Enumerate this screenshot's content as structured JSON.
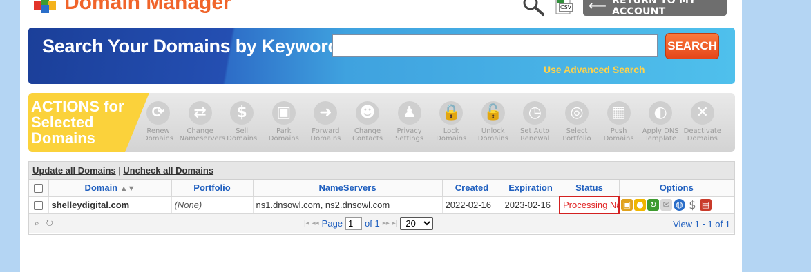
{
  "header": {
    "brand": "Domain Manager",
    "return_label": "RETURN TO MY ACCOUNT",
    "csv_label": "CSV"
  },
  "search": {
    "title": "Search Your Domains by Keyword",
    "input_value": "",
    "button_label": "SEARCH",
    "advanced_link": "Use Advanced Search"
  },
  "actions": {
    "label_lines": [
      "ACTIONS for",
      "Selected",
      "Domains"
    ],
    "items": [
      {
        "line1": "Renew",
        "line2": "Domains",
        "glyph": "⟳"
      },
      {
        "line1": "Change",
        "line2": "Nameservers",
        "glyph": "⇄"
      },
      {
        "line1": "Sell",
        "line2": "Domains",
        "glyph": "$"
      },
      {
        "line1": "Park",
        "line2": "Domains",
        "glyph": "▣"
      },
      {
        "line1": "Forward",
        "line2": "Domains",
        "glyph": "➜"
      },
      {
        "line1": "Change",
        "line2": "Contacts",
        "glyph": "☻"
      },
      {
        "line1": "Privacy",
        "line2": "Settings",
        "glyph": "♟"
      },
      {
        "line1": "Lock",
        "line2": "Domains",
        "glyph": "🔒"
      },
      {
        "line1": "Unlock",
        "line2": "Domains",
        "glyph": "🔓"
      },
      {
        "line1": "Set Auto",
        "line2": "Renewal",
        "glyph": "◷"
      },
      {
        "line1": "Select",
        "line2": "Portfolio",
        "glyph": "◎"
      },
      {
        "line1": "Push",
        "line2": "Domains",
        "glyph": "▦"
      },
      {
        "line1": "Apply DNS",
        "line2": "Template",
        "glyph": "◐"
      },
      {
        "line1": "Deactivate",
        "line2": "Domains",
        "glyph": "✕"
      }
    ]
  },
  "grid": {
    "update_all": "Update all Domains",
    "separator": "|",
    "uncheck_all": "Uncheck all Domains",
    "columns": {
      "domain": "Domain",
      "portfolio": "Portfolio",
      "nameservers": "NameServers",
      "created": "Created",
      "expiration": "Expiration",
      "status": "Status",
      "options": "Options"
    },
    "rows": [
      {
        "domain": "shelleydigital.com",
        "portfolio": "(None)",
        "nameservers": "ns1.dnsowl.com, ns2.dnsowl.com",
        "created": "2022-02-16",
        "expiration": "2023-02-16",
        "status": "Processing Na"
      }
    ],
    "pager": {
      "page_label": "Page",
      "page_value": "1",
      "of_label": "of 1",
      "rows_per_page": "20",
      "view_text": "View 1 - 1 of 1"
    }
  },
  "colors": {
    "brand_orange": "#f0642a",
    "link_blue": "#1f5fbf",
    "status_red": "#e02020",
    "actions_yellow": "#fbd23b"
  }
}
